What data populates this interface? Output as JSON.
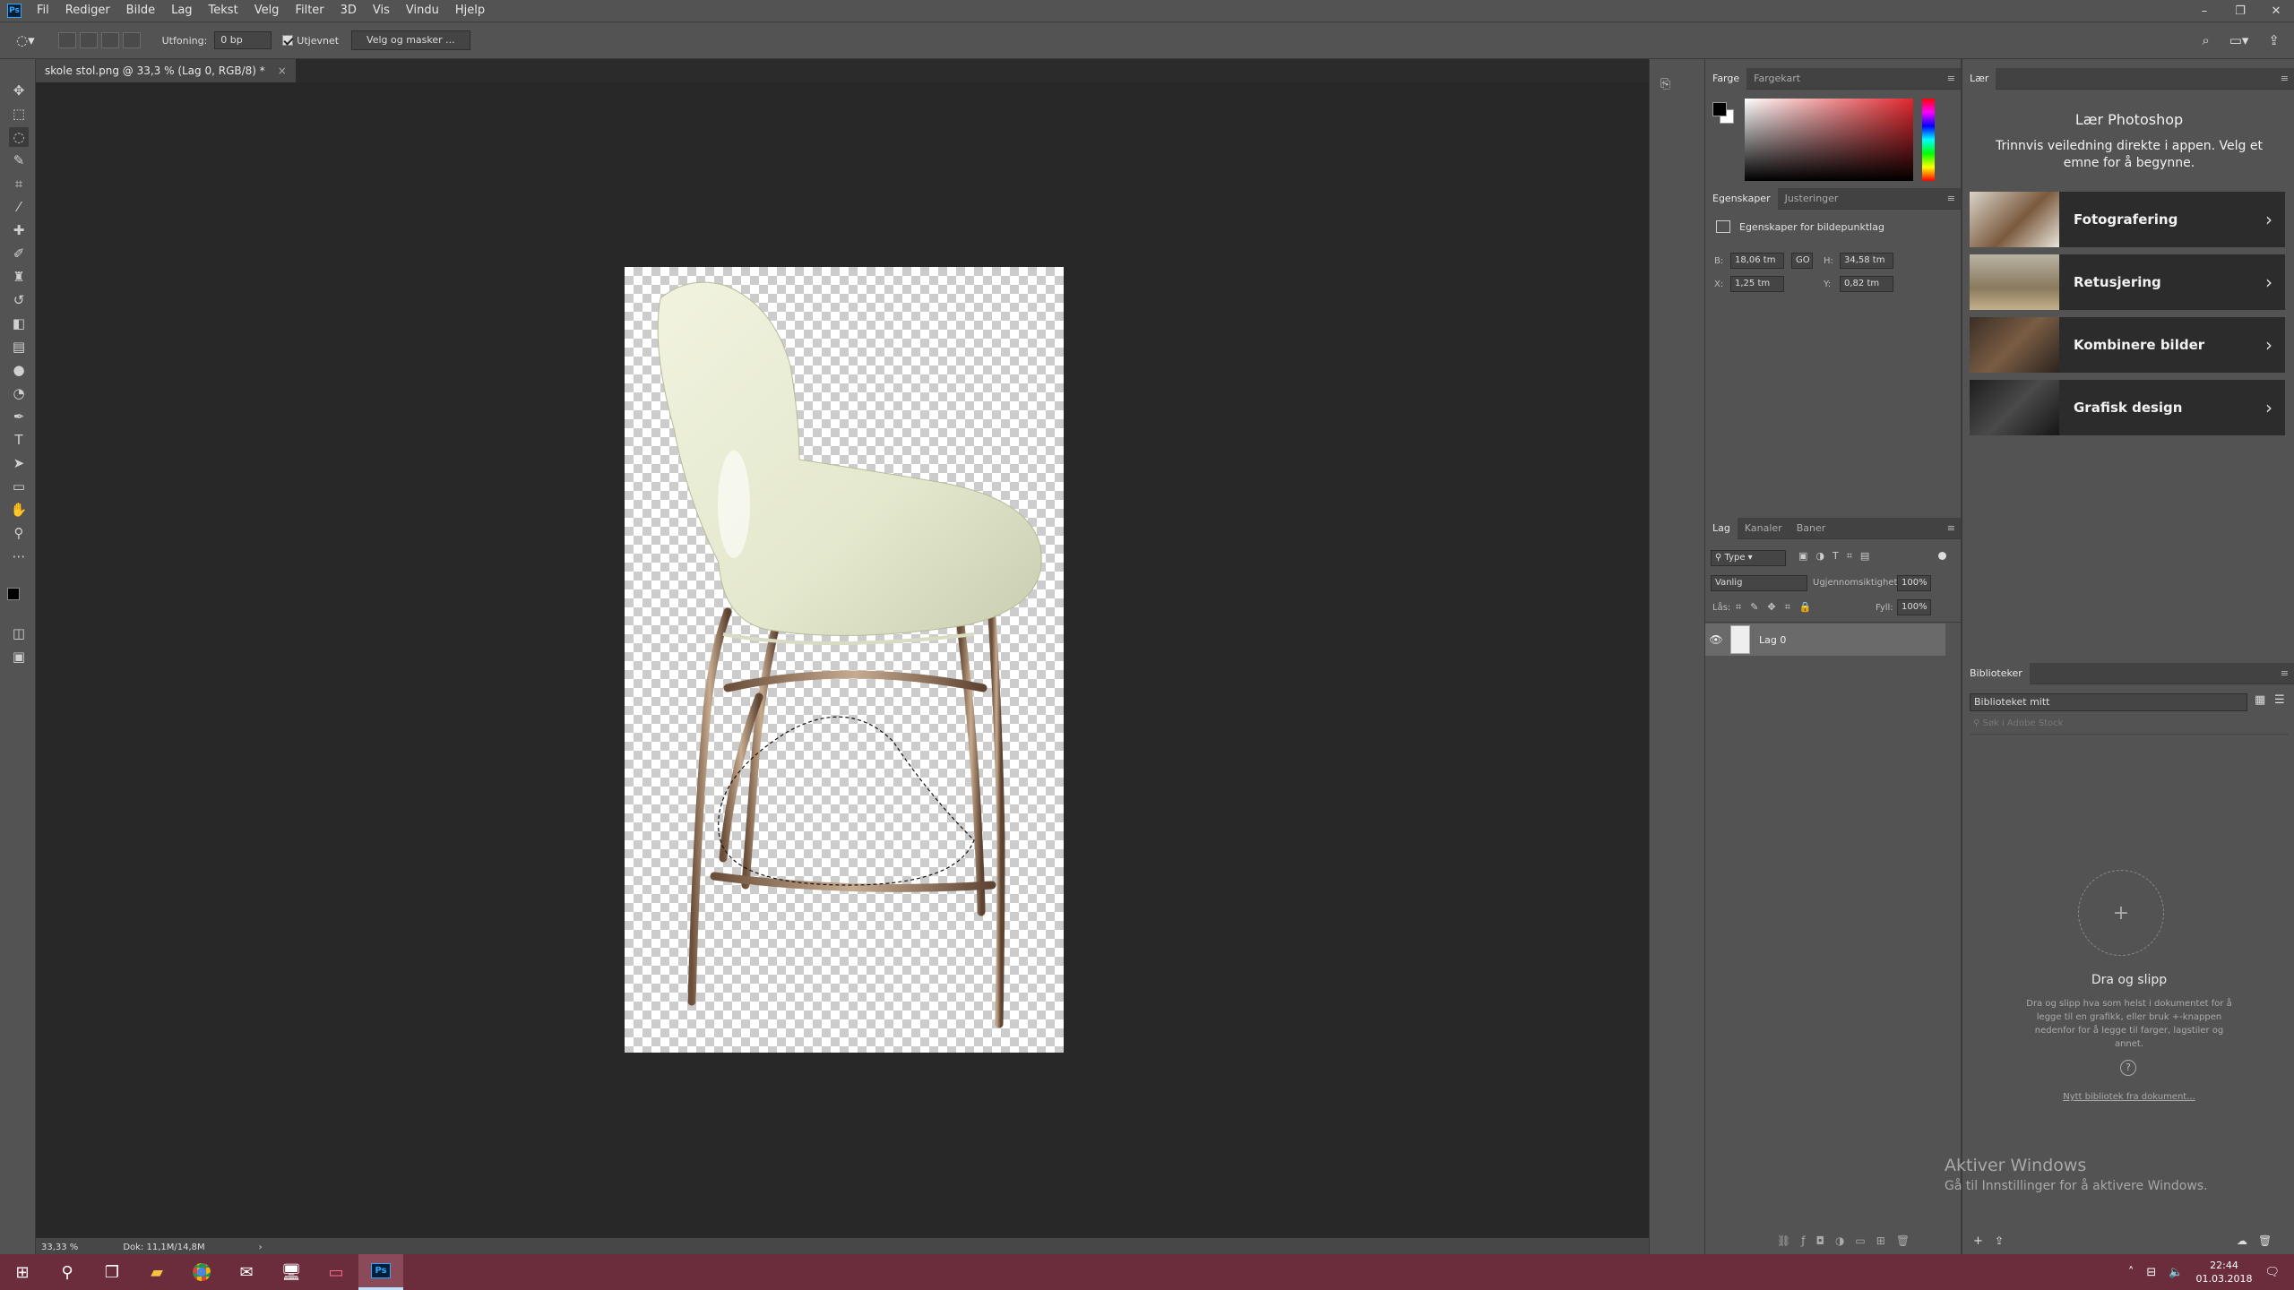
{
  "menubar": {
    "app_icon": "Ps",
    "items": [
      "Fil",
      "Rediger",
      "Bilde",
      "Lag",
      "Tekst",
      "Velg",
      "Filter",
      "3D",
      "Vis",
      "Vindu",
      "Hjelp"
    ],
    "window_buttons": [
      "–",
      "❐",
      "✕"
    ]
  },
  "options": {
    "feather_label": "Utfoning:",
    "feather_value": "0 bp",
    "antialias_label": "Utjevnet",
    "antialias_checked": true,
    "select_mask_label": "Velg og masker ..."
  },
  "tools": [
    "move-icon",
    "marquee-icon",
    "lasso-icon",
    "quick-select-icon",
    "crop-icon",
    "eyedropper-icon",
    "healing-icon",
    "brush-icon",
    "stamp-icon",
    "history-brush-icon",
    "eraser-icon",
    "gradient-icon",
    "blur-icon",
    "dodge-icon",
    "pen-icon",
    "type-icon",
    "path-select-icon",
    "rectangle-icon",
    "hand-icon",
    "zoom-icon",
    "more-icon"
  ],
  "document": {
    "tab_title": "skole stol.png @ 33,3 % (Lag 0, RGB/8) *",
    "close": "×"
  },
  "status": {
    "zoom": "33,33 %",
    "doc_info": "Dok: 11,1M/14,8M",
    "arrow": "›"
  },
  "color_panel": {
    "tabs": [
      "Farge",
      "Fargekart"
    ],
    "foreground": "#000000",
    "background": "#ffffff",
    "hue_color": "#e0282e"
  },
  "properties_panel": {
    "tabs": [
      "Egenskaper",
      "Justeringer"
    ],
    "heading": "Egenskaper for bildepunktlag",
    "w_label": "B:",
    "w_value": "18,06 tm",
    "link": "GO",
    "h_label": "H:",
    "h_value": "34,58 tm",
    "x_label": "X:",
    "x_value": "1,25 tm",
    "y_label": "Y:",
    "y_value": "0,82 tm"
  },
  "layers_panel": {
    "tabs": [
      "Lag",
      "Kanaler",
      "Baner"
    ],
    "filter_label": "Type",
    "blend_mode": "Vanlig",
    "opacity_label": "Ugjennomsiktighet:",
    "opacity_value": "100%",
    "lock_label": "Lås:",
    "fill_label": "Fyll:",
    "fill_value": "100%",
    "layers": [
      {
        "name": "Lag 0",
        "visible": true
      }
    ]
  },
  "learn_panel": {
    "tab": "Lær",
    "title": "Lær Photoshop",
    "subtitle": "Trinnvis veiledning direkte i appen. Velg et emne for å begynne.",
    "cards": [
      "Fotografering",
      "Retusjering",
      "Kombinere bilder",
      "Grafisk design"
    ]
  },
  "libraries_panel": {
    "tab": "Biblioteker",
    "library": "Biblioteket mitt",
    "search_placeholder": "Søk i Adobe Stock",
    "drop_title": "Dra og slipp",
    "drop_text": "Dra og slipp hva som helst i dokumentet for å legge til en grafikk, eller bruk +-knappen nedenfor for å legge til farger, lagstiler og annet.",
    "help": "?",
    "link": "Nytt bibliotek fra dokument..."
  },
  "watermark": {
    "title": "Aktiver Windows",
    "text": "Gå til Innstillinger for å aktivere Windows."
  },
  "taskbar": {
    "clock": "22:44",
    "date": "01.03.2018"
  }
}
